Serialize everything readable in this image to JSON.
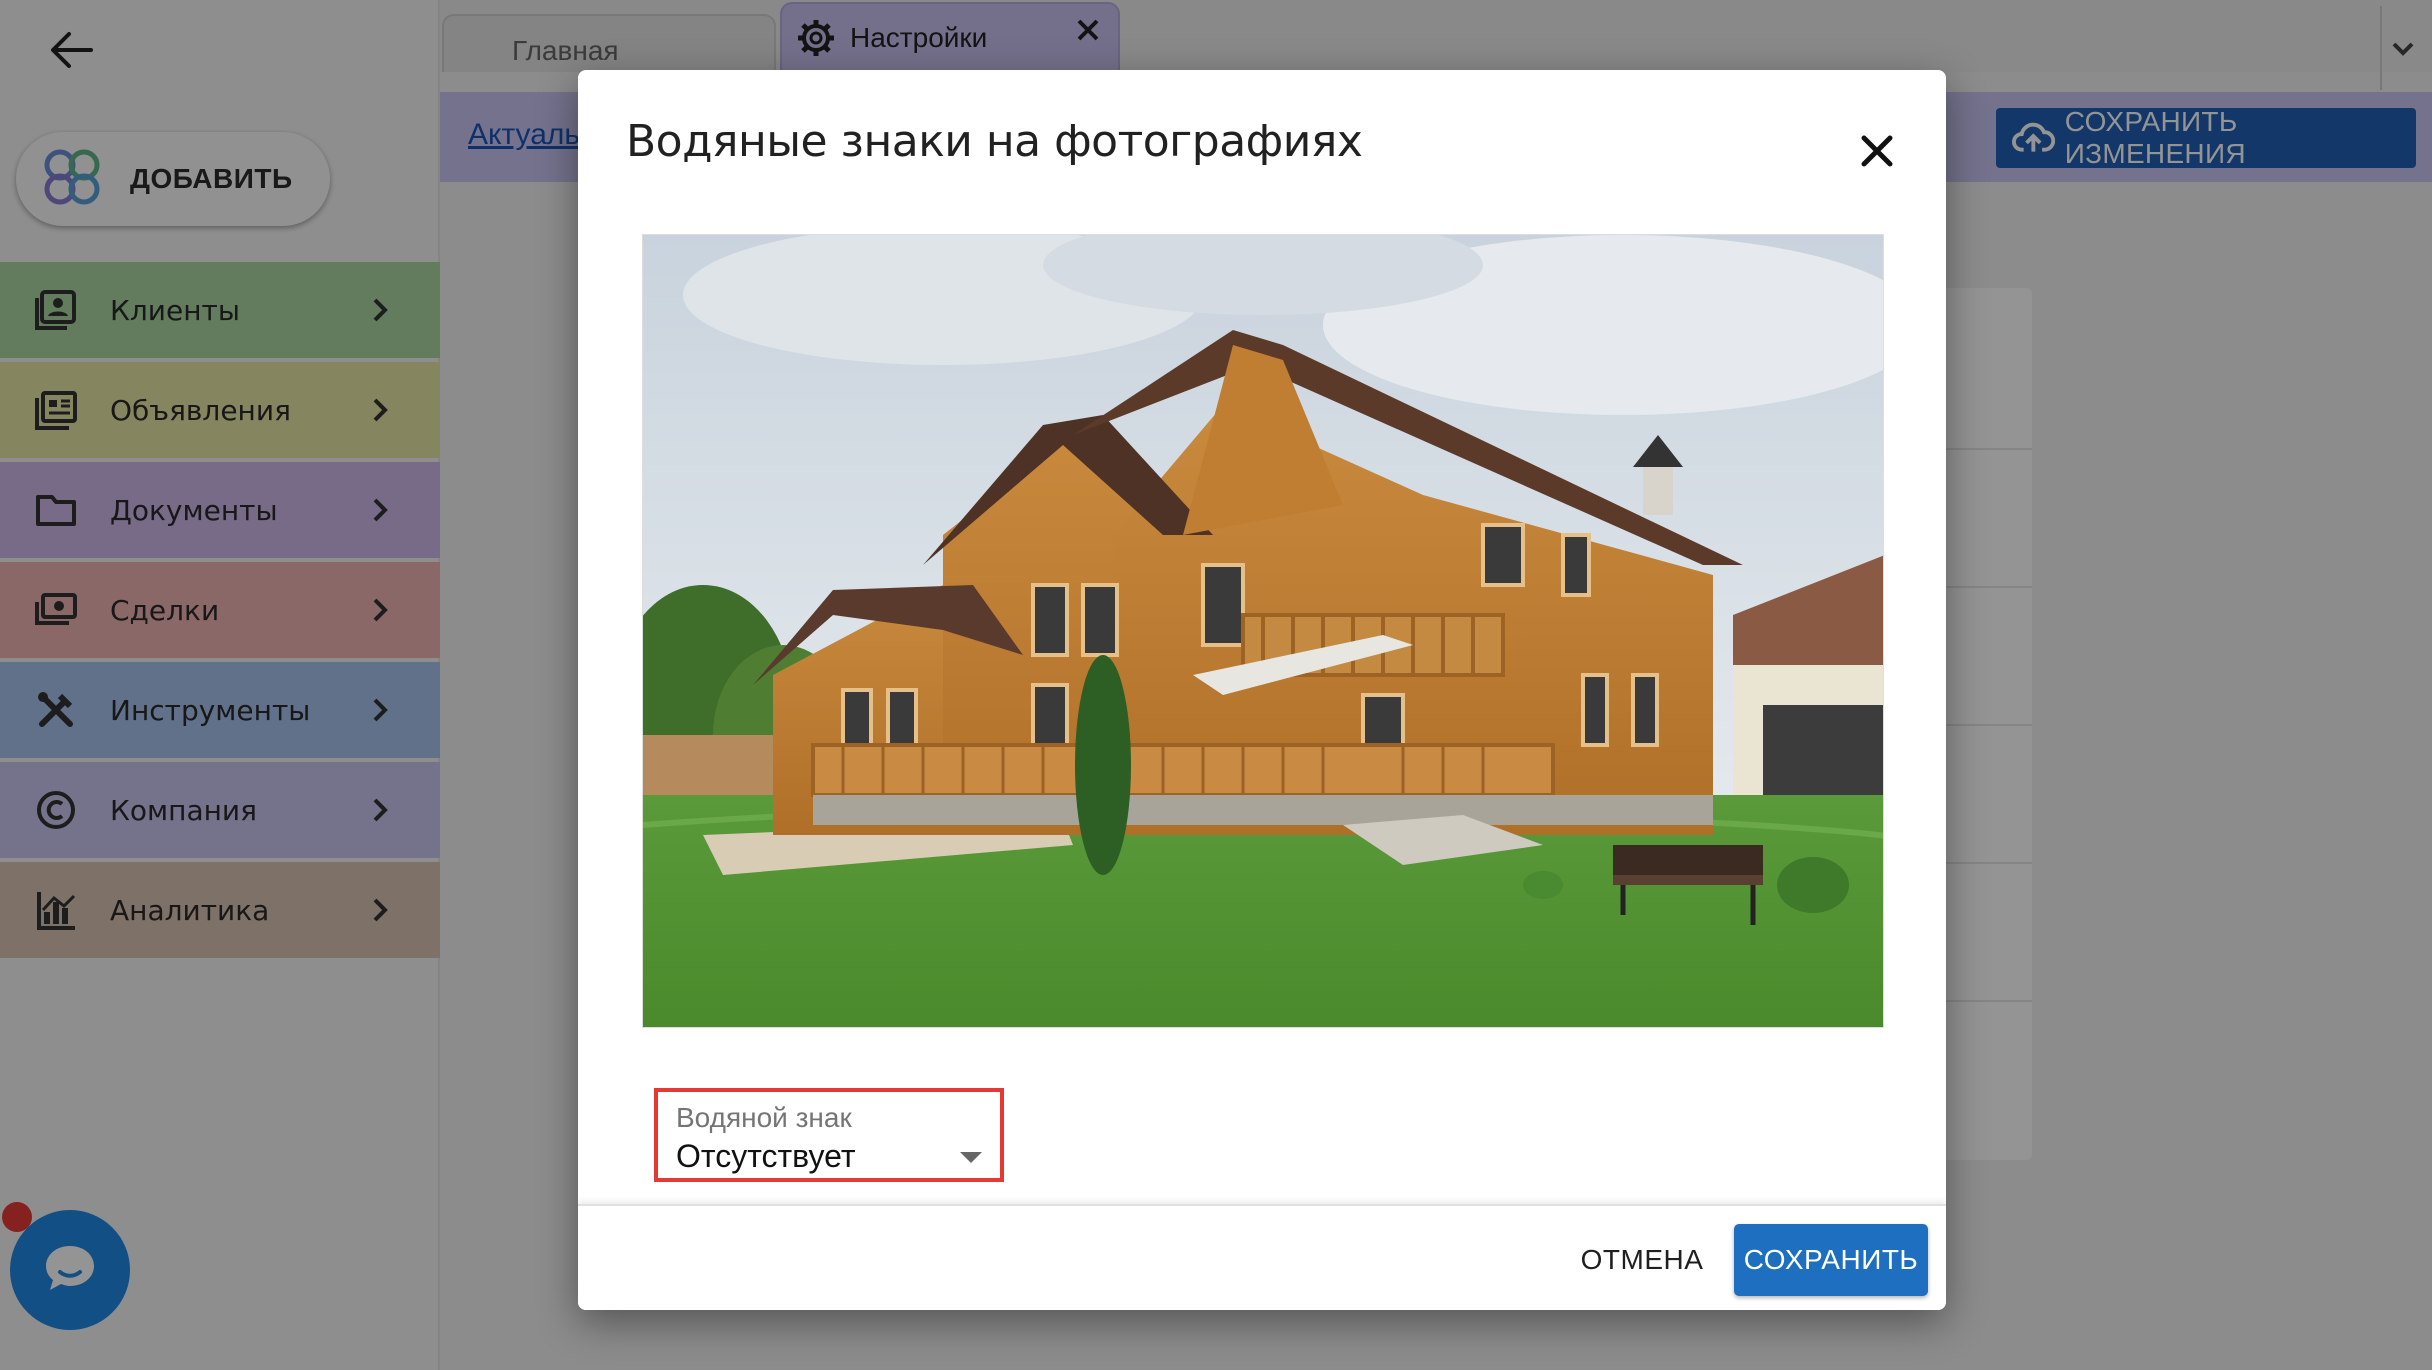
{
  "sidebar": {
    "add_label": "ДОБАВИТЬ",
    "items": [
      {
        "label": "Клиенты",
        "icon": "contacts-icon",
        "color": "#a9d6a0"
      },
      {
        "label": "Объявления",
        "icon": "listings-icon",
        "color": "#e6e6a6"
      },
      {
        "label": "Документы",
        "icon": "folder-icon",
        "color": "#cdb8ea"
      },
      {
        "label": "Сделки",
        "icon": "money-icon",
        "color": "#eeb3b2"
      },
      {
        "label": "Инструменты",
        "icon": "tools-icon",
        "color": "#a7c3ee"
      },
      {
        "label": "Компания",
        "icon": "copyright-icon",
        "color": "#c8c6f0"
      },
      {
        "label": "Аналитика",
        "icon": "analytics-icon",
        "color": "#d9c3b3"
      }
    ]
  },
  "tabs": {
    "home_label": "Главная",
    "settings_label": "Настройки"
  },
  "toolbar": {
    "link_label": "Актуаль",
    "save_changes_label": "СОХРАНИТЬ ИЗМЕНЕНИЯ"
  },
  "modal": {
    "title": "Водяные знаки на фотографиях",
    "watermark_select": {
      "label": "Водяной знак",
      "value": "Отсутствует"
    },
    "cancel_label": "ОТМЕНА",
    "save_label": "СОХРАНИТЬ"
  },
  "colors": {
    "accent": "#1e6fc0",
    "highlight": "#e53935",
    "chat": "#1e88e5"
  }
}
